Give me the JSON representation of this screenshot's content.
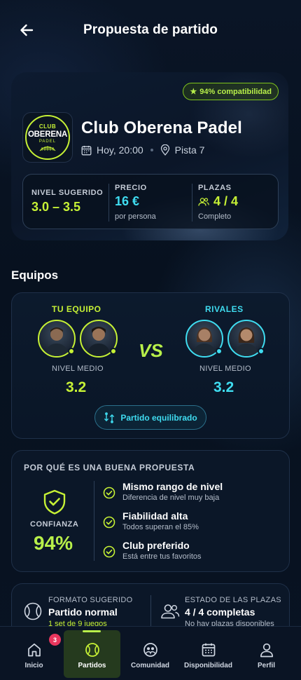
{
  "header": {
    "title": "Propuesta de partido"
  },
  "hero": {
    "compat_label": "94% compatibilidad",
    "logo": {
      "top": "CLUB",
      "main": "OBERENA",
      "sub": "PADEL"
    },
    "club_name": "Club Oberena Padel",
    "time": "Hoy, 20:00",
    "court": "Pista 7",
    "stats": {
      "level": {
        "label": "NIVEL SUGERIDO",
        "value": "3.0 – 3.5"
      },
      "price": {
        "label": "PRECIO",
        "value": "16 €",
        "sub": "por persona"
      },
      "slots": {
        "label": "PLAZAS",
        "value": "4 / 4",
        "sub": "Completo"
      }
    }
  },
  "teams": {
    "section_title": "Equipos",
    "my_team": {
      "label": "TU EQUIPO",
      "level_label": "NIVEL MEDIO",
      "level": "3.2"
    },
    "rivals": {
      "label": "RIVALES",
      "level_label": "NIVEL MEDIO",
      "level": "3.2"
    },
    "vs": "VS",
    "balanced_label": "Partido equilibrado"
  },
  "why": {
    "title": "POR QUÉ ES UNA BUENA PROPUESTA",
    "confidence_label": "CONFIANZA",
    "confidence_value": "94%",
    "reasons": [
      {
        "title": "Mismo rango de nivel",
        "sub": "Diferencia de nivel muy baja"
      },
      {
        "title": "Fiabilidad alta",
        "sub": "Todos superan el 85%"
      },
      {
        "title": "Club preferido",
        "sub": "Está entre tus favoritos"
      }
    ]
  },
  "format": {
    "suggested": {
      "label": "FORMATO SUGERIDO",
      "value": "Partido normal",
      "sub": "1 set de 9 juegos"
    },
    "slots_state": {
      "label": "ESTADO DE LAS PLAZAS",
      "value": "4 / 4 completas",
      "sub": "No hay plazas disponibles"
    }
  },
  "tabbar": {
    "items": [
      {
        "label": "Inicio",
        "icon": "home-icon",
        "badge": "3"
      },
      {
        "label": "Partidos",
        "icon": "ball-icon",
        "active": true
      },
      {
        "label": "Comunidad",
        "icon": "community-icon"
      },
      {
        "label": "Disponibilidad",
        "icon": "calendar-icon"
      },
      {
        "label": "Perfil",
        "icon": "user-icon"
      }
    ]
  },
  "colors": {
    "accent_green": "#b8f04a",
    "accent_cyan": "#3fdcf0",
    "background": "#06101f",
    "badge_red": "#e8365d"
  }
}
